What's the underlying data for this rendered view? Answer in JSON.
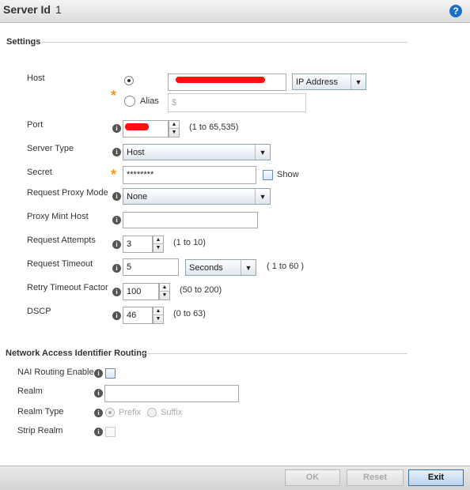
{
  "header": {
    "title": "Server Id",
    "server_id": "1",
    "help_icon": "?"
  },
  "settings": {
    "section_title": "Settings",
    "host": {
      "label": "Host",
      "host_value": "",
      "host_type_select": "IP Address",
      "alias_label": "Alias",
      "alias_placeholder": "$"
    },
    "port": {
      "label": "Port",
      "value": "",
      "hint": "(1 to 65,535)"
    },
    "server_type": {
      "label": "Server Type",
      "value": "Host"
    },
    "secret": {
      "label": "Secret",
      "value": "********",
      "show_label": "Show"
    },
    "request_proxy_mode": {
      "label": "Request Proxy Mode",
      "value": "None"
    },
    "proxy_mint_host": {
      "label": "Proxy Mint Host",
      "value": ""
    },
    "request_attempts": {
      "label": "Request Attempts",
      "value": "3",
      "hint": "(1 to 10)"
    },
    "request_timeout": {
      "label": "Request Timeout",
      "value": "5",
      "unit": "Seconds",
      "hint": "( 1 to 60 )"
    },
    "retry_timeout_factor": {
      "label": "Retry Timeout Factor",
      "value": "100",
      "hint": "(50 to 200)"
    },
    "dscp": {
      "label": "DSCP",
      "value": "46",
      "hint": "(0 to 63)"
    }
  },
  "nai": {
    "section_title": "Network Access Identifier Routing",
    "routing_enable_label": "NAI Routing Enable",
    "realm_label": "Realm",
    "realm_value": "",
    "realm_type_label": "Realm Type",
    "prefix_label": "Prefix",
    "suffix_label": "Suffix",
    "strip_realm_label": "Strip Realm"
  },
  "footer": {
    "ok_label": "OK",
    "reset_label": "Reset",
    "exit_label": "Exit"
  },
  "colors": {
    "accent": "#1b6fc8",
    "required": "#f39a1a",
    "redaction": "#ff1010"
  }
}
